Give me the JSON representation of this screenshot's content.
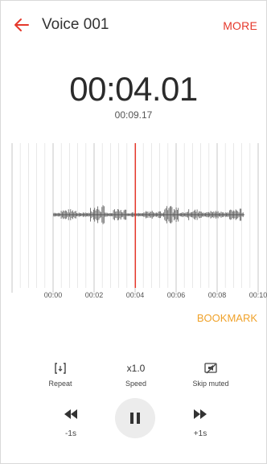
{
  "header": {
    "title": "Voice 001",
    "more_label": "MORE"
  },
  "player": {
    "elapsed": "00:04.01",
    "total": "00:09.17",
    "progress_seconds": 4.01,
    "duration_seconds": 9.17
  },
  "timeline": {
    "ticks": [
      "00:00",
      "00:02",
      "00:04",
      "00:06",
      "00:08",
      "00:10"
    ]
  },
  "bookmark_label": "BOOKMARK",
  "controls": {
    "repeat_label": "Repeat",
    "speed_value": "x1.0",
    "speed_label": "Speed",
    "skip_muted_label": "Skip muted",
    "rewind_label": "-1s",
    "forward_label": "+1s"
  },
  "colors": {
    "accent": "#e5382b",
    "bookmark": "#f0a22a"
  },
  "icons": [
    "back-arrow-icon",
    "repeat-icon",
    "skip-muted-icon",
    "rewind-icon",
    "pause-icon",
    "fast-forward-icon"
  ]
}
